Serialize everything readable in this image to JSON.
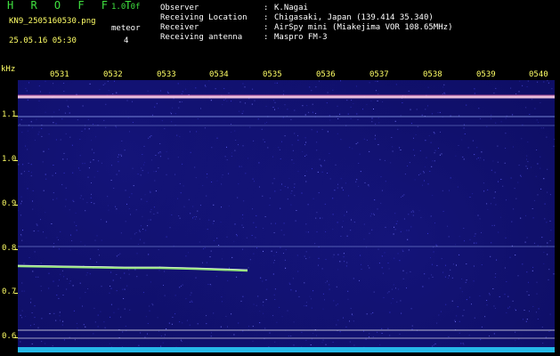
{
  "header": {
    "app_title": "H R O F F T",
    "app_version": "1.0.0f",
    "file_name": "KN9_2505160530.png",
    "mode_label": "meteor",
    "mode_count": "4",
    "datetime": "25.05.16 05:30"
  },
  "meta": [
    {
      "key": "Observer",
      "sep": ":",
      "value": "K.Nagai"
    },
    {
      "key": "Receiving Location",
      "sep": ":",
      "value": "Chigasaki, Japan (139.414 35.340)"
    },
    {
      "key": "Receiver",
      "sep": ":",
      "value": "AirSpy mini (Miakejima VOR 108.65MHz)"
    },
    {
      "key": "Receiving antenna",
      "sep": ":",
      "value": "Maspro FM-3"
    }
  ],
  "y_axis": {
    "label": "kHz",
    "ticks": [
      {
        "label": "1.1",
        "value": 1.1
      },
      {
        "label": "1.0",
        "value": 1.0
      },
      {
        "label": "0.9",
        "value": 0.9
      },
      {
        "label": "0.8",
        "value": 0.8
      },
      {
        "label": "0.7",
        "value": 0.7
      },
      {
        "label": "0.6",
        "value": 0.6
      }
    ]
  },
  "x_axis": {
    "ticks": [
      "0531",
      "0532",
      "0533",
      "0534",
      "0535",
      "0536",
      "0537",
      "0538",
      "0539",
      "0540"
    ]
  },
  "colors": {
    "background": "#000000",
    "title_green": "#3fe03f",
    "label_yellow": "#ffff66",
    "spectrogram_bg": "#0d0d62",
    "carrier": "#ffd0e8",
    "meteor_trail": "#9cf07a",
    "noise_floor": "#29d6ff",
    "marker_line": "#ffffff"
  }
}
